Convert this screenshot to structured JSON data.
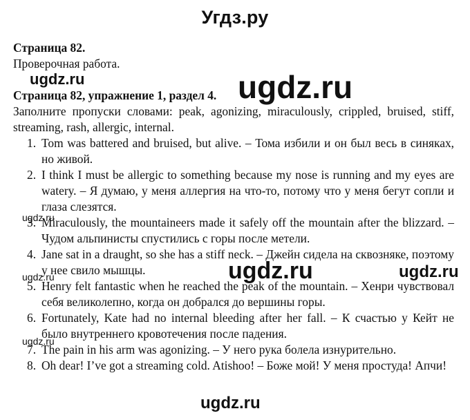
{
  "site_title": "Угдз.ру",
  "heading_page": "Страница 82.",
  "subtitle": "Проверочная работа.",
  "heading_exercise": "Страница 82, упражнение 1, раздел 4.",
  "instruction": "Заполните пропуски словами: peak, agonizing, miraculously, crippled, bruised, stiff, streaming, rash, allergic, internal.",
  "items": [
    {
      "num": "1.",
      "text": "Tom was battered and bruised, but alive. – Тома избили и он был весь в синяках, но живой."
    },
    {
      "num": "2.",
      "text": "I think I must be allergic to something because my nose is running and my eyes are watery. – Я думаю, у меня аллергия на что-то, потому что у меня бегут сопли и глаза слезятся."
    },
    {
      "num": "3.",
      "text": "Miraculously, the mountaineers made it safely off the mountain after the blizzard. – Чудом альпинисты спустились с горы после метели."
    },
    {
      "num": "4.",
      "text": "Jane sat in a draught, so she has a stiff neck. – Джейн сидела на сквозняке, поэтому у нее свило мышцы."
    },
    {
      "num": "5.",
      "text": "Henry felt fantastic when he reached the peak of the mountain. – Хенри чувствовал себя великолепно, когда он добрался до вершины горы."
    },
    {
      "num": "6.",
      "text": "Fortunately, Kate had no internal bleeding after her fall. – К счастью у Кейт не было внутреннего кровотечения после падения."
    },
    {
      "num": "7.",
      "text": "The pain in his arm was agonizing. – У него рука болела изнурительно."
    },
    {
      "num": "8.",
      "text": "Oh dear! I’ve got a streaming cold. Atishoo! – Боже мой! У меня простуда! Апчи!"
    }
  ],
  "watermarks": {
    "large": "ugdz.ru",
    "medium": "ugdz.ru",
    "small": "ugdz.ru"
  }
}
